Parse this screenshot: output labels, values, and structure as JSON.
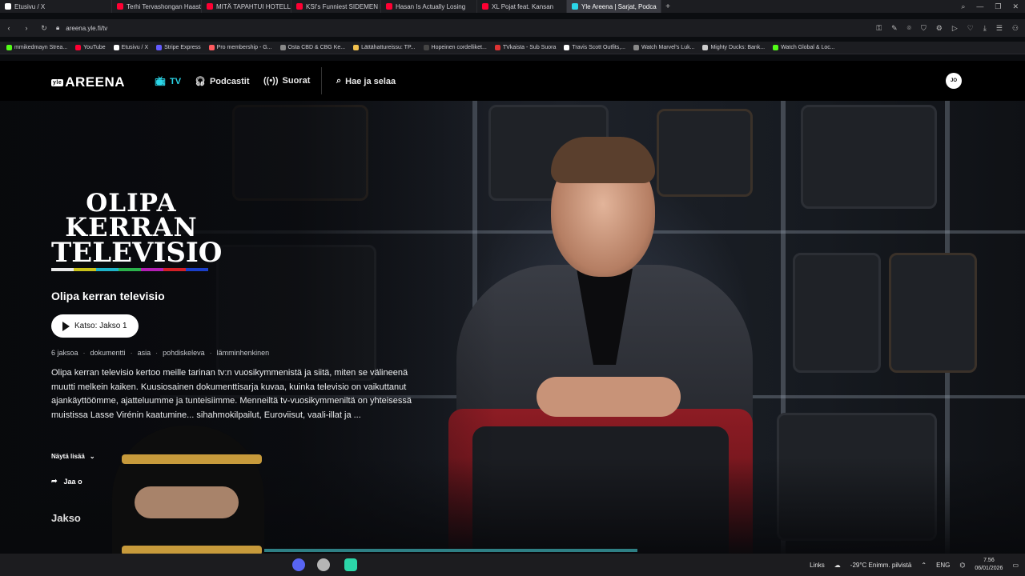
{
  "browser": {
    "tabs": [
      {
        "label": "Etusivu / X",
        "color": "#ffffff"
      },
      {
        "label": "Terhi Tervashongan Haast",
        "color": "#ff0033"
      },
      {
        "label": "MITÄ TAPAHTUI HOTELLI",
        "color": "#ff0033"
      },
      {
        "label": "KSI's Funniest SIDEMEN M",
        "color": "#ff0033"
      },
      {
        "label": "Hasan Is Actually Losing",
        "color": "#ff0033"
      },
      {
        "label": "XL Pojat feat. Kansan",
        "color": "#ff0033"
      },
      {
        "label": "Yle Areena | Sarjat, Podca",
        "color": "#2bd6e8"
      }
    ],
    "url": "areena.yle.fi/tv",
    "bookmarks": [
      {
        "label": "mmikedmayn Strea...",
        "color": "#53fc18"
      },
      {
        "label": "YouTube",
        "color": "#ff0033"
      },
      {
        "label": "Etusivu / X",
        "color": "#ffffff"
      },
      {
        "label": "Stripe Express",
        "color": "#635bff"
      },
      {
        "label": "Pro membership - G...",
        "color": "#ff5a5f"
      },
      {
        "label": "Osta CBD & CBG Ke...",
        "color": "#888888"
      },
      {
        "label": "Lättähattureissu: TP...",
        "color": "#f2c14e"
      },
      {
        "label": "Hopeinen cordelliket...",
        "color": "#444444"
      },
      {
        "label": "TVkaista - Sub Suora",
        "color": "#d33"
      },
      {
        "label": "Travis Scott Outfits,...",
        "color": "#ffffff"
      },
      {
        "label": "Watch Marvel's Luk...",
        "color": "#888888"
      },
      {
        "label": "Mighty Ducks: Bank...",
        "color": "#cccccc"
      },
      {
        "label": "Watch Global & Loc...",
        "color": "#53fc18"
      }
    ]
  },
  "areena": {
    "logo_badge": "yle",
    "logo_text": "AREENA",
    "nav": {
      "tv": "TV",
      "podcasts": "Podcastit",
      "live": "Suorat",
      "search": "Hae ja selaa"
    },
    "avatar_initials": "JO",
    "accent": "#2bd6e8"
  },
  "hero": {
    "logo_lines": [
      "OLIPA",
      "KERRAN",
      "TELEVISIO"
    ],
    "logo_colors": [
      "#e8e8e8",
      "#c9c21b",
      "#1fb4c8",
      "#2bb24c",
      "#b41fb4",
      "#d32027",
      "#1b3fc9"
    ],
    "title": "Olipa kerran televisio",
    "play_label": "Katso: Jakso 1",
    "meta": [
      "6 jaksoa",
      "dokumentti",
      "asia",
      "pohdiskeleva",
      "lämminhenkinen"
    ],
    "description": "Olipa kerran televisio kertoo meille tarinan tv:n vuosikymmenistä ja siitä, miten se välineenä muutti melkein kaiken. Kuusiosainen dokumenttisarja kuvaa, kuinka televisio on vaikuttanut ajankäyttöömme, ajatteluumme ja tunteisiimme. Menneiltä tv-vuosikymmeniltä on yhteisessä muistissa Lasse Virénin kaatumine... sihahmokilpailut, Euroviisut, vaali-illat ja ...",
    "show_more": "Näytä lisää",
    "share": "Jaa o",
    "section_heading": "Jakso"
  },
  "taskbar": {
    "links": "Links",
    "weather": "-29°C  Enimm. pilvistä",
    "lang": "ENG",
    "time": "7.56",
    "date": "06/01/2026"
  }
}
